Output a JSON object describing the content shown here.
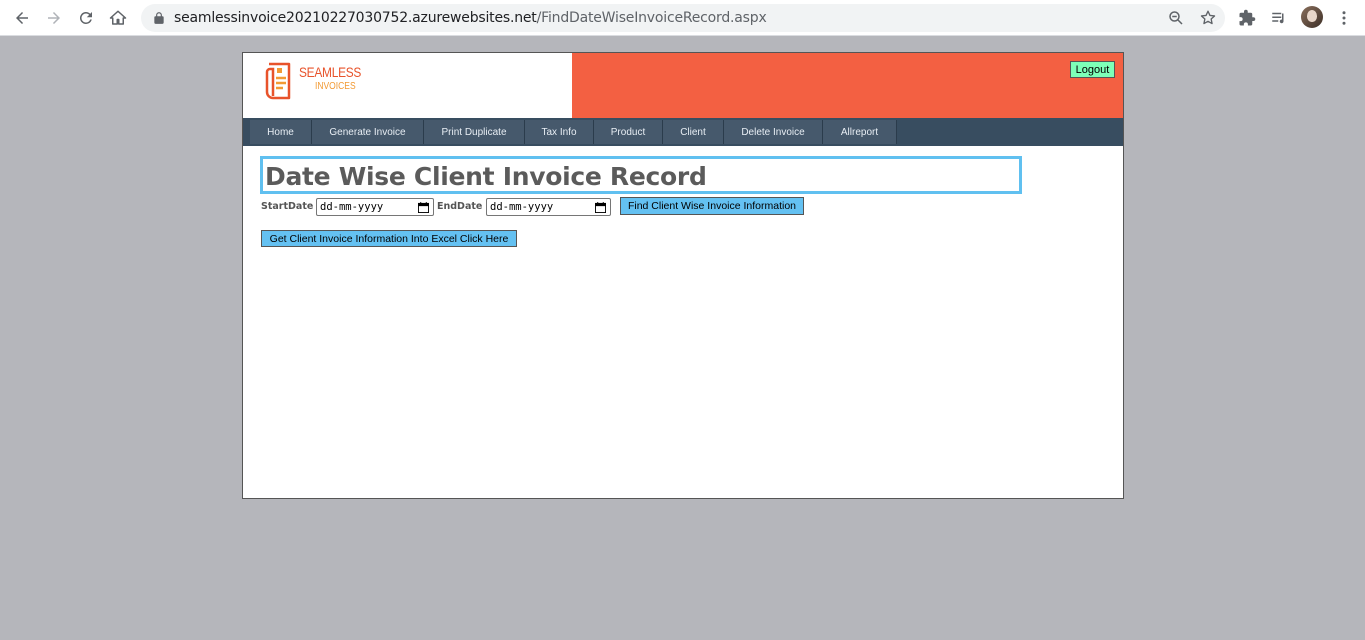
{
  "browser": {
    "url_host": "seamlessinvoice20210227030752.azurewebsites.net",
    "url_path": "/FindDateWiseInvoiceRecord.aspx",
    "icons": [
      "back-arrow-icon",
      "forward-arrow-icon",
      "reload-icon",
      "home-icon",
      "lock-icon",
      "zoom-icon",
      "star-icon",
      "puzzle-icon",
      "media-queue-icon",
      "avatar",
      "kebab-menu-icon"
    ]
  },
  "header": {
    "logo_line1": "SEAMLESS",
    "logo_line2": "INVOICES",
    "logout_label": "Logout",
    "colors": {
      "banner": "#f36042",
      "logout": "#7dffb8"
    }
  },
  "menu": {
    "items": [
      {
        "label": "Home"
      },
      {
        "label": "Generate Invoice"
      },
      {
        "label": "Print Duplicate"
      },
      {
        "label": "Tax Info"
      },
      {
        "label": "Product"
      },
      {
        "label": "Client"
      },
      {
        "label": "Delete Invoice"
      },
      {
        "label": "Allreport"
      }
    ],
    "colors": {
      "bar": "#384d60",
      "item": "#46596c"
    }
  },
  "main": {
    "title": "Date Wise Client Invoice Record",
    "start_label": "StartDate :",
    "start_value": "dd-mm-yyyy",
    "end_label": "EndDate :",
    "end_value": "dd-mm-yyyy",
    "find_button": "Find Client Wise Invoice Information",
    "excel_button": "Get Client Invoice Information Into Excel Click Here",
    "colors": {
      "title_border": "#60c0f0",
      "button": "#64c1f2"
    }
  }
}
